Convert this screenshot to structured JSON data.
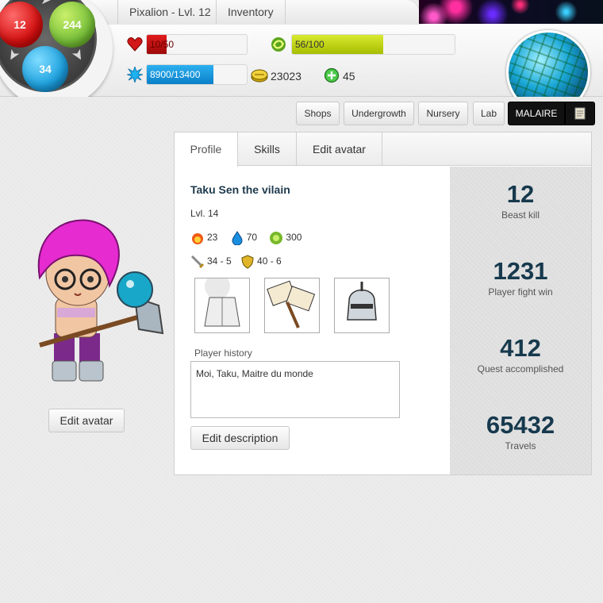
{
  "header": {
    "game_title": "Pixalion - Lvl. 12",
    "inventory_label": "Inventory",
    "hp": {
      "text": "10/50",
      "value": 10,
      "max": 50,
      "color": "#cc1111"
    },
    "stamina": {
      "text": "56/100",
      "value": 56,
      "max": 100,
      "color": "#c3d61a"
    },
    "xp": {
      "text": "8900/13400",
      "value": 8900,
      "max": 13400,
      "color": "#1a93d8"
    },
    "gold": "23023",
    "gems": "45",
    "orbs": {
      "fire": "12",
      "earth": "244",
      "water": "34"
    }
  },
  "nav": {
    "shops": "Shops",
    "undergrowth": "Undergrowth",
    "nursery": "Nursery",
    "lab": "Lab",
    "malaire": "MALAIRE"
  },
  "avatar": {
    "edit_label": "Edit avatar"
  },
  "tabs": [
    "Profile",
    "Skills",
    "Edit avatar"
  ],
  "profile": {
    "name": "Taku Sen the vilain",
    "level": "Lvl. 14",
    "elements": {
      "fire": "23",
      "water": "70",
      "earth": "300"
    },
    "attack": "34 - 5",
    "defense": "40 - 6",
    "history_label": "Player history",
    "history_text": "Moi, Taku, Maitre du monde",
    "edit_description_label": "Edit description"
  },
  "stats": [
    {
      "value": "12",
      "label": "Beast kill"
    },
    {
      "value": "1231",
      "label": "Player fight win"
    },
    {
      "value": "412",
      "label": "Quest accomplished"
    },
    {
      "value": "65432",
      "label": "Travels"
    }
  ],
  "icons": {
    "hp": "heart-icon",
    "stamina": "stamina-swirl-icon",
    "xp": "xp-star-icon",
    "gold": "gold-coins-icon",
    "gems": "green-gem-icon",
    "scroll": "scroll-icon"
  }
}
